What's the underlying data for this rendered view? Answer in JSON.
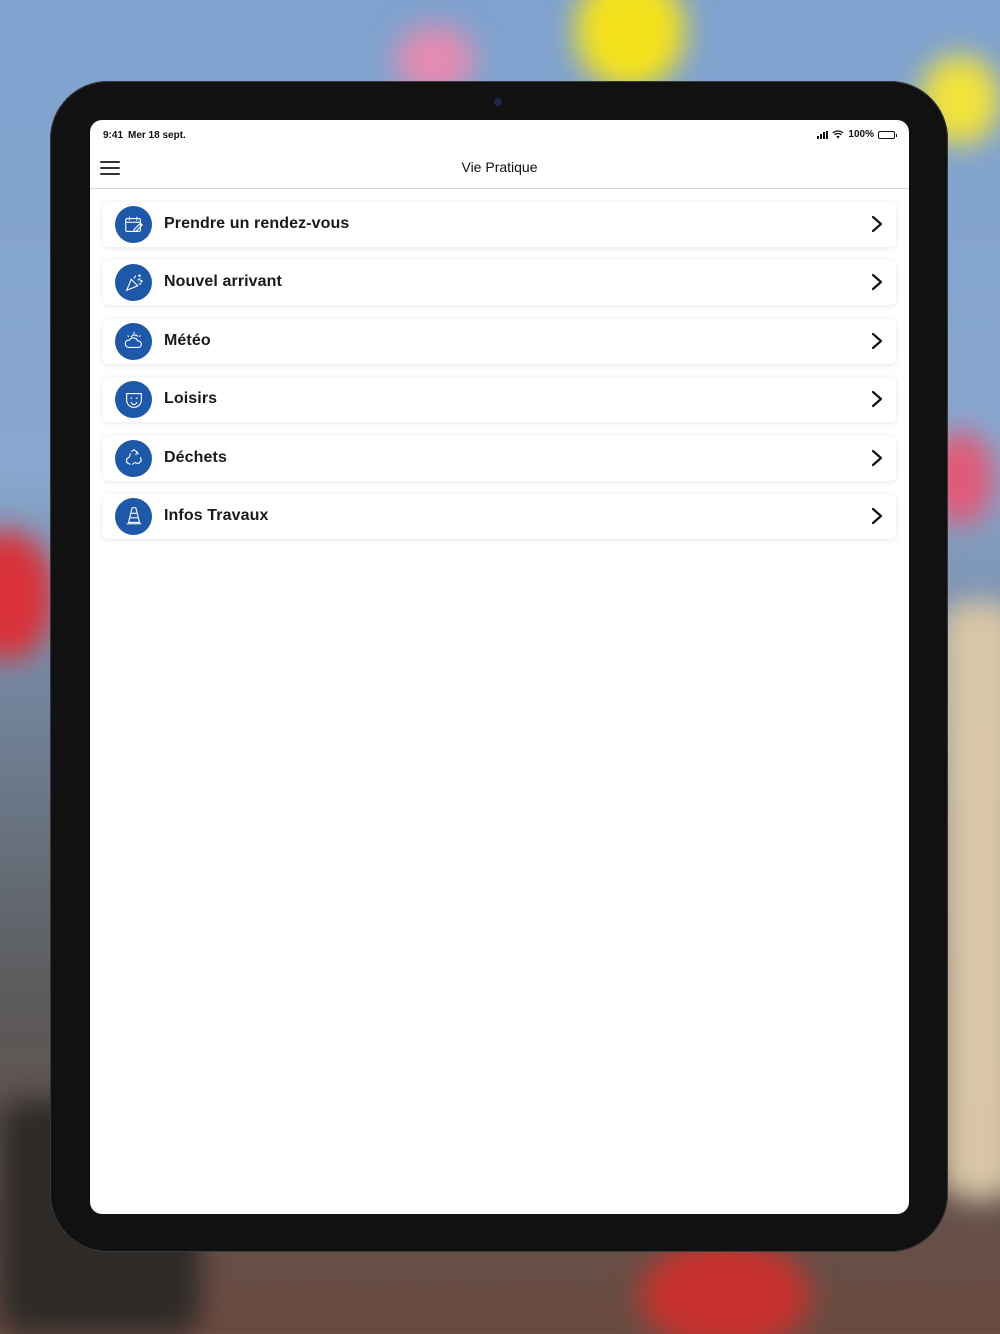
{
  "status_bar": {
    "time": "9:41",
    "date": "Mer 18 sept.",
    "battery": "100%"
  },
  "header": {
    "title": "Vie Pratique",
    "menu_icon": "hamburger-menu-icon"
  },
  "menu": {
    "items": [
      {
        "label": "Prendre un rendez-vous",
        "icon": "calendar-edit-icon"
      },
      {
        "label": "Nouvel arrivant",
        "icon": "party-popper-icon"
      },
      {
        "label": "Météo",
        "icon": "sun-cloud-icon"
      },
      {
        "label": "Loisirs",
        "icon": "theater-masks-icon"
      },
      {
        "label": "Déchets",
        "icon": "recycle-icon"
      },
      {
        "label": "Infos Travaux",
        "icon": "traffic-cone-icon"
      }
    ]
  },
  "colors": {
    "accent": "#1e58a8",
    "text": "#1a1a1a",
    "background": "#ffffff"
  }
}
